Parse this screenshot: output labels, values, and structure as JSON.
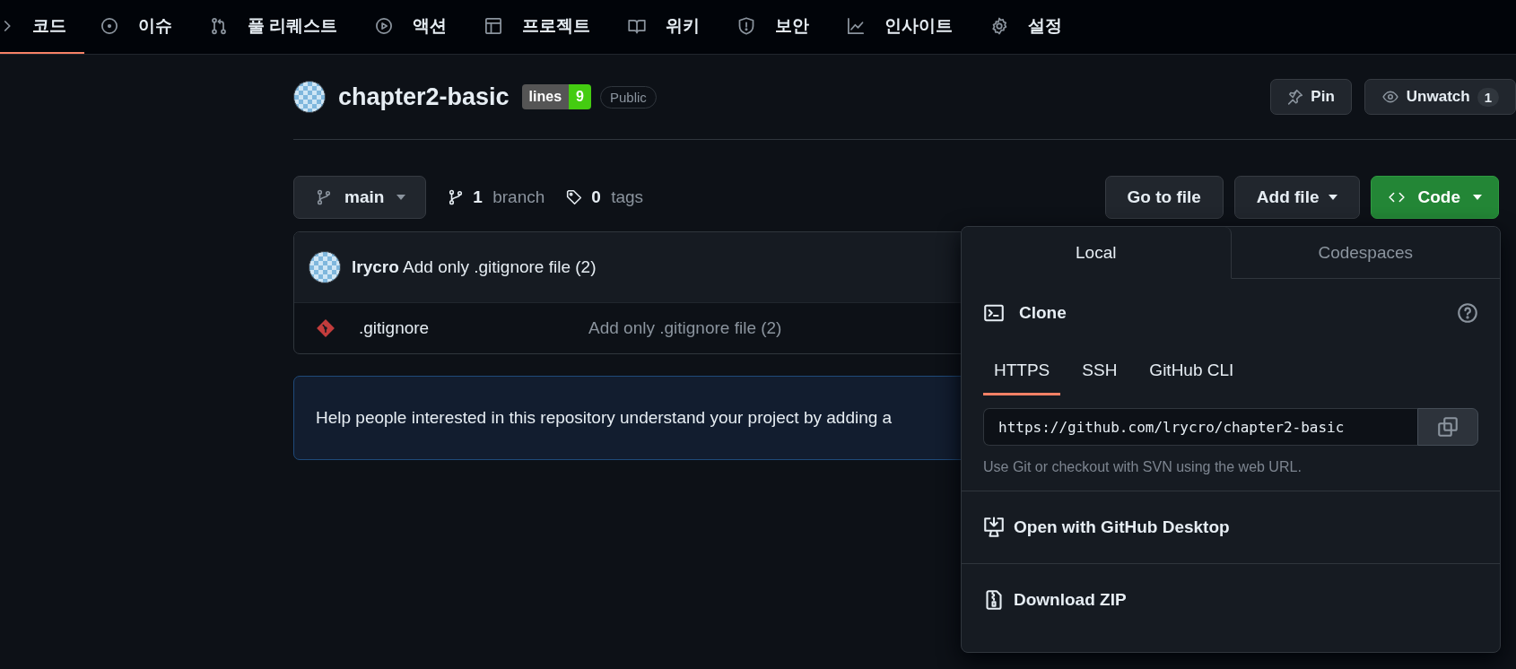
{
  "nav": {
    "items": [
      {
        "label": "코드",
        "selected": true
      },
      {
        "label": "이슈",
        "selected": false
      },
      {
        "label": "풀 리퀘스트",
        "selected": false
      },
      {
        "label": "액션",
        "selected": false
      },
      {
        "label": "프로젝트",
        "selected": false
      },
      {
        "label": "위키",
        "selected": false
      },
      {
        "label": "보안",
        "selected": false
      },
      {
        "label": "인사이트",
        "selected": false
      },
      {
        "label": "설정",
        "selected": false
      }
    ]
  },
  "repo": {
    "name": "chapter2-basic",
    "badge": {
      "label": "lines",
      "value": "9"
    },
    "visibility": "Public",
    "actions": [
      {
        "label": "Pin"
      },
      {
        "label": "Unwatch",
        "count": "1"
      }
    ]
  },
  "toolbar": {
    "branch": "main",
    "branch_count": "1",
    "branch_label": "branch",
    "tag_count": "0",
    "tag_label": "tags",
    "buttons": [
      {
        "label": "Go to file",
        "kind": "plain"
      },
      {
        "label": "Add file",
        "kind": "menu"
      },
      {
        "label": "Code",
        "kind": "primary"
      }
    ]
  },
  "commit": {
    "author": "lrycro",
    "message": "Add only .gitignore file (2)"
  },
  "files": [
    {
      "name": ".gitignore",
      "message": "Add only .gitignore file (2)"
    }
  ],
  "readme_banner": {
    "text": "Help people interested in this repository understand your project by adding a"
  },
  "clone_menu": {
    "tabs": [
      {
        "label": "Local",
        "selected": true
      },
      {
        "label": "Codespaces",
        "selected": false
      }
    ],
    "title": "Clone",
    "protocols": [
      {
        "label": "HTTPS",
        "selected": true
      },
      {
        "label": "SSH",
        "selected": false
      },
      {
        "label": "GitHub CLI",
        "selected": false
      }
    ],
    "url": "https://github.com/lrycro/chapter2-basic",
    "hint": "Use Git or checkout with SVN using the web URL.",
    "actions": [
      {
        "label": "Open with GitHub Desktop"
      },
      {
        "label": "Download ZIP"
      }
    ]
  }
}
